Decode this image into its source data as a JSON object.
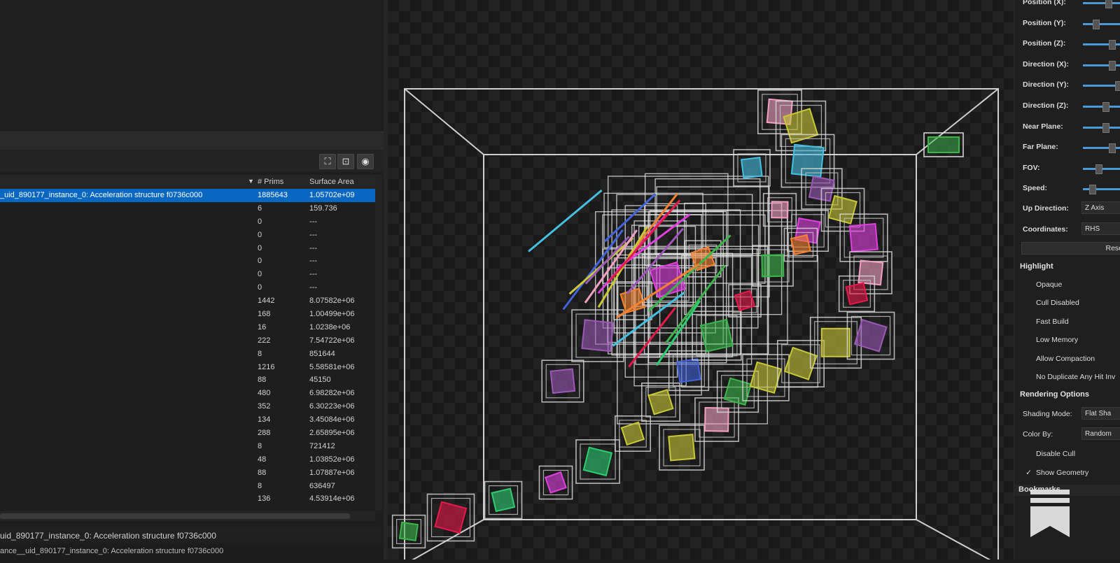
{
  "left_panel": {
    "toolbar": {
      "expand_icon": "expand-icon",
      "collapse_icon": "collapse-icon",
      "eye_icon": "eye-icon"
    },
    "table": {
      "columns": [
        "# Prims",
        "Surface Area"
      ],
      "rows": [
        {
          "name": "_uid_890177_instance_0: Acceleration structure f0736c000",
          "prims": "1885643",
          "area": "1.05702e+09",
          "selected": true
        },
        {
          "name": "",
          "prims": "6",
          "area": "159.736"
        },
        {
          "name": "",
          "prims": "0",
          "area": "---"
        },
        {
          "name": "",
          "prims": "0",
          "area": "---"
        },
        {
          "name": "",
          "prims": "0",
          "area": "---"
        },
        {
          "name": "",
          "prims": "0",
          "area": "---"
        },
        {
          "name": "",
          "prims": "0",
          "area": "---"
        },
        {
          "name": "",
          "prims": "0",
          "area": "---"
        },
        {
          "name": "",
          "prims": "1442",
          "area": "8.07582e+06"
        },
        {
          "name": "",
          "prims": "168",
          "area": "1.00499e+06"
        },
        {
          "name": "",
          "prims": "16",
          "area": "1.0238e+06"
        },
        {
          "name": "",
          "prims": "222",
          "area": "7.54722e+06"
        },
        {
          "name": "",
          "prims": "8",
          "area": "851644"
        },
        {
          "name": "",
          "prims": "1216",
          "area": "5.58581e+06"
        },
        {
          "name": "",
          "prims": "88",
          "area": "45150"
        },
        {
          "name": "",
          "prims": "480",
          "area": "6.98282e+06"
        },
        {
          "name": "",
          "prims": "352",
          "area": "6.30223e+06"
        },
        {
          "name": "",
          "prims": "134",
          "area": "3.45084e+06"
        },
        {
          "name": "",
          "prims": "288",
          "area": "2.65895e+06"
        },
        {
          "name": "",
          "prims": "8",
          "area": "721412"
        },
        {
          "name": "",
          "prims": "48",
          "area": "1.03852e+06"
        },
        {
          "name": "",
          "prims": "88",
          "area": "1.07887e+06"
        },
        {
          "name": "",
          "prims": "8",
          "area": "636497"
        },
        {
          "name": "",
          "prims": "136",
          "area": "4.53914e+06"
        }
      ]
    },
    "status_line_1": "uid_890177_instance_0: Acceleration structure f0736c000",
    "status_line_2": "ance__uid_890177_instance_0: Acceleration structure f0736c000"
  },
  "right_panel": {
    "camera": [
      {
        "label": "Position (X):",
        "level": 0.7
      },
      {
        "label": "Position (Y):",
        "level": 0.3
      },
      {
        "label": "Position (Z):",
        "level": 0.8
      },
      {
        "label": "Direction (X):",
        "level": 0.8
      },
      {
        "label": "Direction (Y):",
        "level": 1.0
      },
      {
        "label": "Direction (Z):",
        "level": 0.6
      },
      {
        "label": "Near Plane:",
        "level": 0.6
      },
      {
        "label": "Far Plane:",
        "level": 0.8
      },
      {
        "label": "FOV:",
        "level": 0.4
      },
      {
        "label": "Speed:",
        "level": 0.2
      }
    ],
    "up_direction": {
      "label": "Up Direction:",
      "value": "Z Axis"
    },
    "coordinates": {
      "label": "Coordinates:",
      "value": "RHS"
    },
    "reset_label": "Rese",
    "highlight": {
      "title": "Highlight",
      "items": [
        {
          "label": "Opaque",
          "checked": false
        },
        {
          "label": "Cull Disabled",
          "checked": false
        },
        {
          "label": "Fast Build",
          "checked": false
        },
        {
          "label": "Low Memory",
          "checked": false
        },
        {
          "label": "Allow Compaction",
          "checked": false
        },
        {
          "label": "No Duplicate Any Hit Inv",
          "checked": false
        }
      ]
    },
    "rendering": {
      "title": "Rendering Options",
      "shading_mode": {
        "label": "Shading Mode:",
        "value": "Flat Sha"
      },
      "color_by": {
        "label": "Color By:",
        "value": "Random"
      },
      "items": [
        {
          "label": "Disable Cull",
          "checked": false
        },
        {
          "label": "Show Geometry",
          "checked": true
        }
      ]
    },
    "bookmarks_title": "Bookmarks"
  },
  "colors": {
    "selection": "#0a67c1",
    "slider": "#4a9ad8",
    "background": "#1b1b1b"
  },
  "icons": {
    "bookmark": "bookmark-icon"
  }
}
